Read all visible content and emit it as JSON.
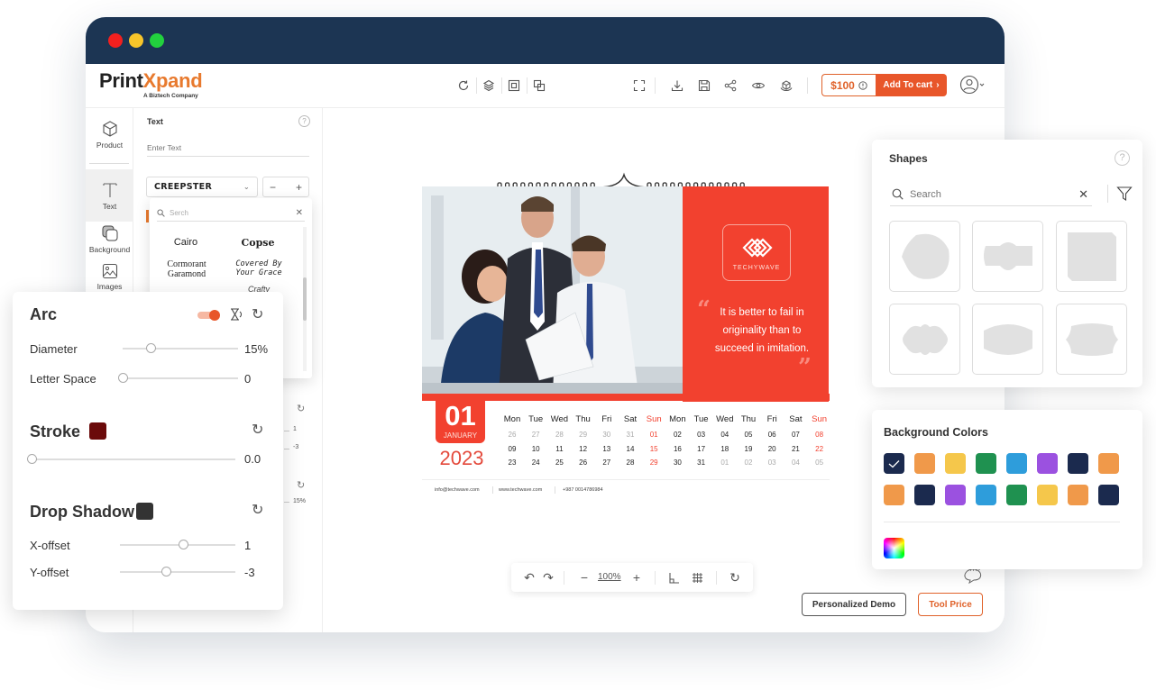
{
  "window": {
    "traffic_lights": [
      {
        "name": "close",
        "color": "#f2201f"
      },
      {
        "name": "minimize",
        "color": "#f7c52a"
      },
      {
        "name": "maximize",
        "color": "#22d13e"
      }
    ]
  },
  "header": {
    "logo_part1": "Print",
    "logo_part2": "Xpand",
    "logo_tagline": "A Biztech Company",
    "left_tools": [
      "refresh-icon",
      "layers-icon",
      "bring-front-icon",
      "duplicate-icon"
    ],
    "right_tools": [
      "fullscreen-icon",
      "download-icon",
      "save-icon",
      "share-icon",
      "preview-icon",
      "3d-view-icon"
    ],
    "price": "$100",
    "add_to_cart": "Add To cart",
    "accent": "#e8562a"
  },
  "rail": {
    "items": [
      {
        "label": "Product",
        "icon": "cube-icon"
      },
      {
        "label": "Text",
        "icon": "text-icon",
        "active": true
      },
      {
        "label": "Background",
        "icon": "background-icon"
      },
      {
        "label": "Images",
        "icon": "image-icon"
      }
    ]
  },
  "text_panel": {
    "title": "Text",
    "text_placeholder": "Enter Text",
    "font_selected": "CREEPSTER",
    "font_search_placeholder": "Serch",
    "fonts": [
      "Cairo",
      "Copse",
      "Cormorant Garamond",
      "Covered By Your Grace",
      "Crafty"
    ],
    "partial_values": {
      "x_offset": "1",
      "y_offset": "-3",
      "diameter": "15%"
    }
  },
  "arc_panel": {
    "title": "Arc",
    "toggle_on": true,
    "diameter_label": "Diameter",
    "diameter_value": "15%",
    "diameter_fraction": 0.24,
    "letter_space_label": "Letter Space",
    "letter_space_value": "0",
    "letter_space_fraction": 0.0,
    "stroke_title": "Stroke",
    "stroke_color": "#6b0a0a",
    "stroke_value": "0.0",
    "stroke_fraction": 0.0,
    "shadow_title": "Drop Shadow",
    "shadow_color": "#333333",
    "x_offset_label": "X-offset",
    "x_offset_value": "1",
    "x_offset_fraction": 0.55,
    "y_offset_label": "Y-offset",
    "y_offset_value": "-3",
    "y_offset_fraction": 0.4
  },
  "calendar": {
    "company": "TECHYWAVE",
    "quote": "It is better to fail in originality than to succeed in imitation.",
    "month_num": "01",
    "month_name": "JANUARY",
    "year": "2023",
    "weekdays": [
      "Mon",
      "Tue",
      "Wed",
      "Thu",
      "Fri",
      "Sat",
      "Sun",
      "Mon",
      "Tue",
      "Wed",
      "Thu",
      "Fri",
      "Sat",
      "Sun"
    ],
    "rows": [
      [
        "26",
        "27",
        "28",
        "29",
        "30",
        "31",
        "01",
        "02",
        "03",
        "04",
        "05",
        "06",
        "07",
        "08"
      ],
      [
        "09",
        "10",
        "11",
        "12",
        "13",
        "14",
        "15",
        "16",
        "17",
        "18",
        "19",
        "20",
        "21",
        "22"
      ],
      [
        "23",
        "24",
        "25",
        "26",
        "27",
        "28",
        "29",
        "30",
        "31",
        "01",
        "02",
        "03",
        "04",
        "05"
      ]
    ],
    "muted": [
      [
        0,
        0
      ],
      [
        0,
        1
      ],
      [
        0,
        2
      ],
      [
        0,
        3
      ],
      [
        0,
        4
      ],
      [
        0,
        5
      ],
      [
        2,
        9
      ],
      [
        2,
        10
      ],
      [
        2,
        11
      ],
      [
        2,
        12
      ],
      [
        2,
        13
      ]
    ],
    "red": "#f2412f",
    "footer": [
      "info@techwave.com",
      "www.techwave.com",
      "+987 0014786984"
    ]
  },
  "zoombar": {
    "zoom": "100%"
  },
  "buttons": {
    "demo": "Personalized Demo",
    "tool_price": "Tool Price"
  },
  "shapes_panel": {
    "title": "Shapes",
    "search_placeholder": "Search",
    "shapes": [
      "blob",
      "label-notched",
      "square-cut",
      "cloud-label",
      "oval-badge",
      "scalloped-label"
    ]
  },
  "bg_colors": {
    "title": "Background Colors",
    "selected_index": 0,
    "colors": [
      "#1b2a4e",
      "#f0994a",
      "#f5c74b",
      "#1f9150",
      "#2e9ddb",
      "#9b51e0",
      "#1b2a4e",
      "#f0994a",
      "#f0994a",
      "#1b2a4e",
      "#9b51e0",
      "#2e9ddb",
      "#1f9150",
      "#f5c74b",
      "#f0994a",
      "#1b2a4e"
    ]
  }
}
